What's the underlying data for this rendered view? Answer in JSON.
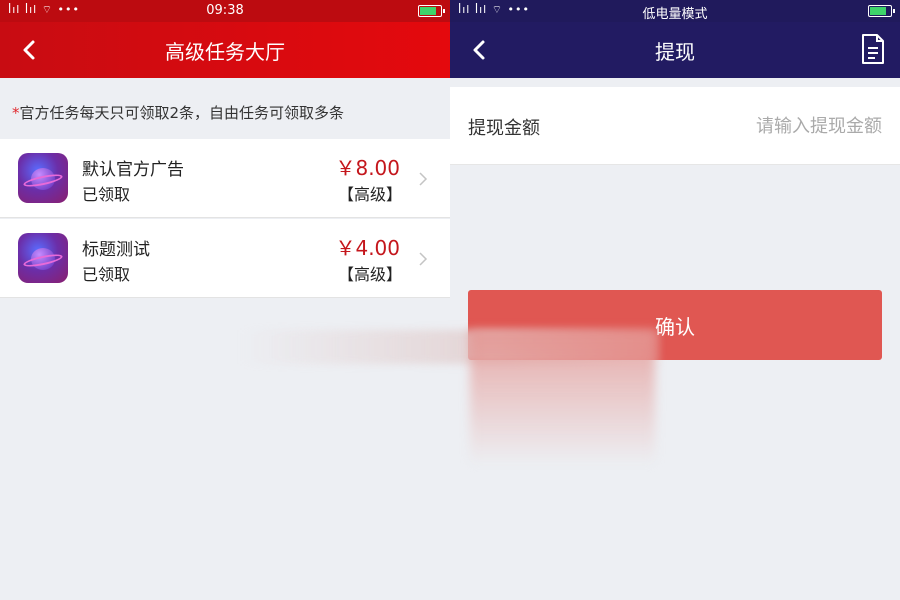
{
  "left_screen": {
    "statusbar": {
      "signals": "ꟾıl ꟾıl ⌔ •••",
      "time": "09:38"
    },
    "navbar": {
      "title": "高级任务大厅"
    },
    "notice": {
      "star": "*",
      "text": "官方任务每天只可领取2条，自由任务可领取多条"
    },
    "tasks": [
      {
        "title": "默认官方广告",
        "status": "已领取",
        "price": "￥8.00",
        "level": "【高级】"
      },
      {
        "title": "标题测试",
        "status": "已领取",
        "price": "￥4.00",
        "level": "【高级】"
      }
    ]
  },
  "right_screen": {
    "statusbar": {
      "signals": "ꟾıl ꟾıl ⌔ •••",
      "mode": "低电量模式"
    },
    "navbar": {
      "title": "提现"
    },
    "amount_field": {
      "label": "提现金额",
      "value": "",
      "placeholder": "请输入提现金额"
    },
    "confirm_label": "确认"
  },
  "colors": {
    "left_header": "#d00b10",
    "right_header": "#221b62",
    "price": "#c4161c",
    "confirm_button": "#e05752",
    "battery": "#3ed36a"
  },
  "icons": [
    "back-arrow-icon",
    "document-icon",
    "chevron-right-icon",
    "planet-app-icon",
    "battery-icon",
    "signal-icon",
    "wifi-icon"
  ]
}
